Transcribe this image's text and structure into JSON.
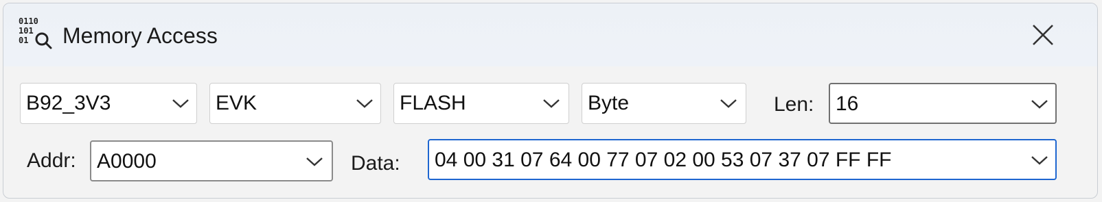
{
  "window": {
    "title": "Memory Access",
    "app_icon": "binary-search-icon",
    "close_icon": "close-icon"
  },
  "row1": {
    "device": "B92_3V3",
    "board": "EVK",
    "memory": "FLASH",
    "width": "Byte",
    "len_label": "Len:",
    "len_value": "16"
  },
  "row2": {
    "addr_label": "Addr:",
    "addr_value": "A0000",
    "data_label": "Data:",
    "data_value": "04 00 31 07 64 00 77 07 02 00 53 07 37 07 FF FF"
  },
  "colors": {
    "focus_border": "#1e66d0",
    "background": "#f3f3f3"
  }
}
